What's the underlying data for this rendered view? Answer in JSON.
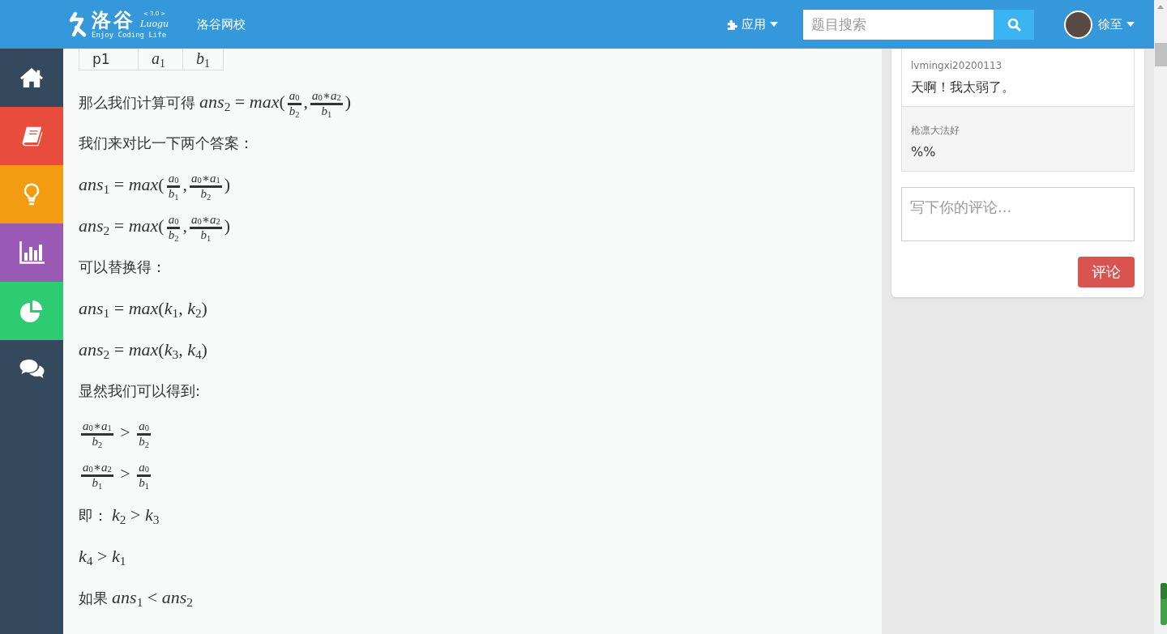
{
  "header": {
    "logo": {
      "brand": "洛谷",
      "version": "< 3.0 >",
      "name": "Luogu",
      "slogan": "Enjoy Coding Life"
    },
    "nav_links": [
      {
        "label": "洛谷网校"
      }
    ],
    "apps_menu": {
      "label": "应用"
    },
    "search": {
      "placeholder": "题目搜索"
    },
    "user": {
      "name": "徐至"
    }
  },
  "sidebar": {
    "items": [
      {
        "kind": "home",
        "color": "#34495e"
      },
      {
        "kind": "book",
        "color": "#e74c3c"
      },
      {
        "kind": "bulb",
        "color": "#f39c12"
      },
      {
        "kind": "barchart",
        "color": "#9b59b6"
      },
      {
        "kind": "piechart",
        "color": "#2ecc71"
      },
      {
        "kind": "chat",
        "color": "#34495e"
      }
    ]
  },
  "article": {
    "table": {
      "rows": [
        [
          {
            "kind": "text",
            "text": "p1"
          },
          {
            "kind": "math",
            "text": "*a*$_{1}$"
          },
          {
            "kind": "math",
            "text": "*b*$_{1}$"
          }
        ]
      ]
    },
    "paragraphs": [
      {
        "parts": [
          {
            "kind": "text",
            "text": "那么我们计算可得"
          },
          {
            "kind": "math",
            "text": "*ans*$_{2}$ = *max*("
          },
          {
            "kind": "frac",
            "num": "*a*$_{0}$",
            "den": "*b*$_{2}$"
          },
          {
            "kind": "math",
            "text": ","
          },
          {
            "kind": "frac",
            "num": "*a*$_{0}$∗*a*$_{2}$",
            "den": "*b*$_{1}$"
          },
          {
            "kind": "math",
            "text": ")"
          }
        ]
      },
      {
        "parts": [
          {
            "kind": "text",
            "text": "我们来对比一下两个答案："
          }
        ]
      },
      {
        "parts": [
          {
            "kind": "math",
            "text": "*ans*$_{1}$ = *max*("
          },
          {
            "kind": "frac",
            "num": "*a*$_{0}$",
            "den": "*b*$_{1}$"
          },
          {
            "kind": "math",
            "text": ","
          },
          {
            "kind": "frac",
            "num": "*a*$_{0}$∗*a*$_{1}$",
            "den": "*b*$_{2}$"
          },
          {
            "kind": "math",
            "text": ")"
          }
        ]
      },
      {
        "parts": [
          {
            "kind": "math",
            "text": "*ans*$_{2}$ = *max*("
          },
          {
            "kind": "frac",
            "num": "*a*$_{0}$",
            "den": "*b*$_{2}$"
          },
          {
            "kind": "math",
            "text": ","
          },
          {
            "kind": "frac",
            "num": "*a*$_{0}$∗*a*$_{2}$",
            "den": "*b*$_{1}$"
          },
          {
            "kind": "math",
            "text": ")"
          }
        ]
      },
      {
        "parts": [
          {
            "kind": "text",
            "text": "可以替换得："
          }
        ]
      },
      {
        "parts": [
          {
            "kind": "math",
            "text": "*ans*$_{1}$ = *max*(*k*$_{1}$, *k*$_{2}$)"
          }
        ]
      },
      {
        "parts": [
          {
            "kind": "math",
            "text": "*ans*$_{2}$ = *max*(*k*$_{3}$, *k*$_{4}$)"
          }
        ]
      },
      {
        "parts": [
          {
            "kind": "text",
            "text": "显然我们可以得到:"
          }
        ]
      },
      {
        "parts": [
          {
            "kind": "frac",
            "num": "*a*$_{0}$∗*a*$_{1}$",
            "den": "*b*$_{2}$"
          },
          {
            "kind": "math",
            "text": " > "
          },
          {
            "kind": "frac",
            "num": "*a*$_{0}$",
            "den": "*b*$_{2}$"
          }
        ]
      },
      {
        "parts": [
          {
            "kind": "frac",
            "num": "*a*$_{0}$∗*a*$_{2}$",
            "den": "*b*$_{1}$"
          },
          {
            "kind": "math",
            "text": " > "
          },
          {
            "kind": "frac",
            "num": "*a*$_{0}$",
            "den": "*b*$_{1}$"
          }
        ]
      },
      {
        "parts": [
          {
            "kind": "text",
            "text": "即："
          },
          {
            "kind": "math",
            "text": "*k*$_{2}$ > *k*$_{3}$"
          }
        ]
      },
      {
        "parts": [
          {
            "kind": "math",
            "text": "*k*$_{4}$ > *k*$_{1}$"
          }
        ]
      },
      {
        "parts": [
          {
            "kind": "text",
            "text": "如果"
          },
          {
            "kind": "math",
            "text": "*ans*$_{1}$ < *ans*$_{2}$"
          }
        ]
      }
    ]
  },
  "comments": {
    "items": [
      {
        "author": "lvmingxi20200113",
        "content": "天啊！我太弱了。"
      },
      {
        "author": "枪凛大法好",
        "content": "%%"
      }
    ],
    "input": {
      "placeholder": "写下你的评论..."
    },
    "submit_button": {
      "label": "评论"
    }
  }
}
